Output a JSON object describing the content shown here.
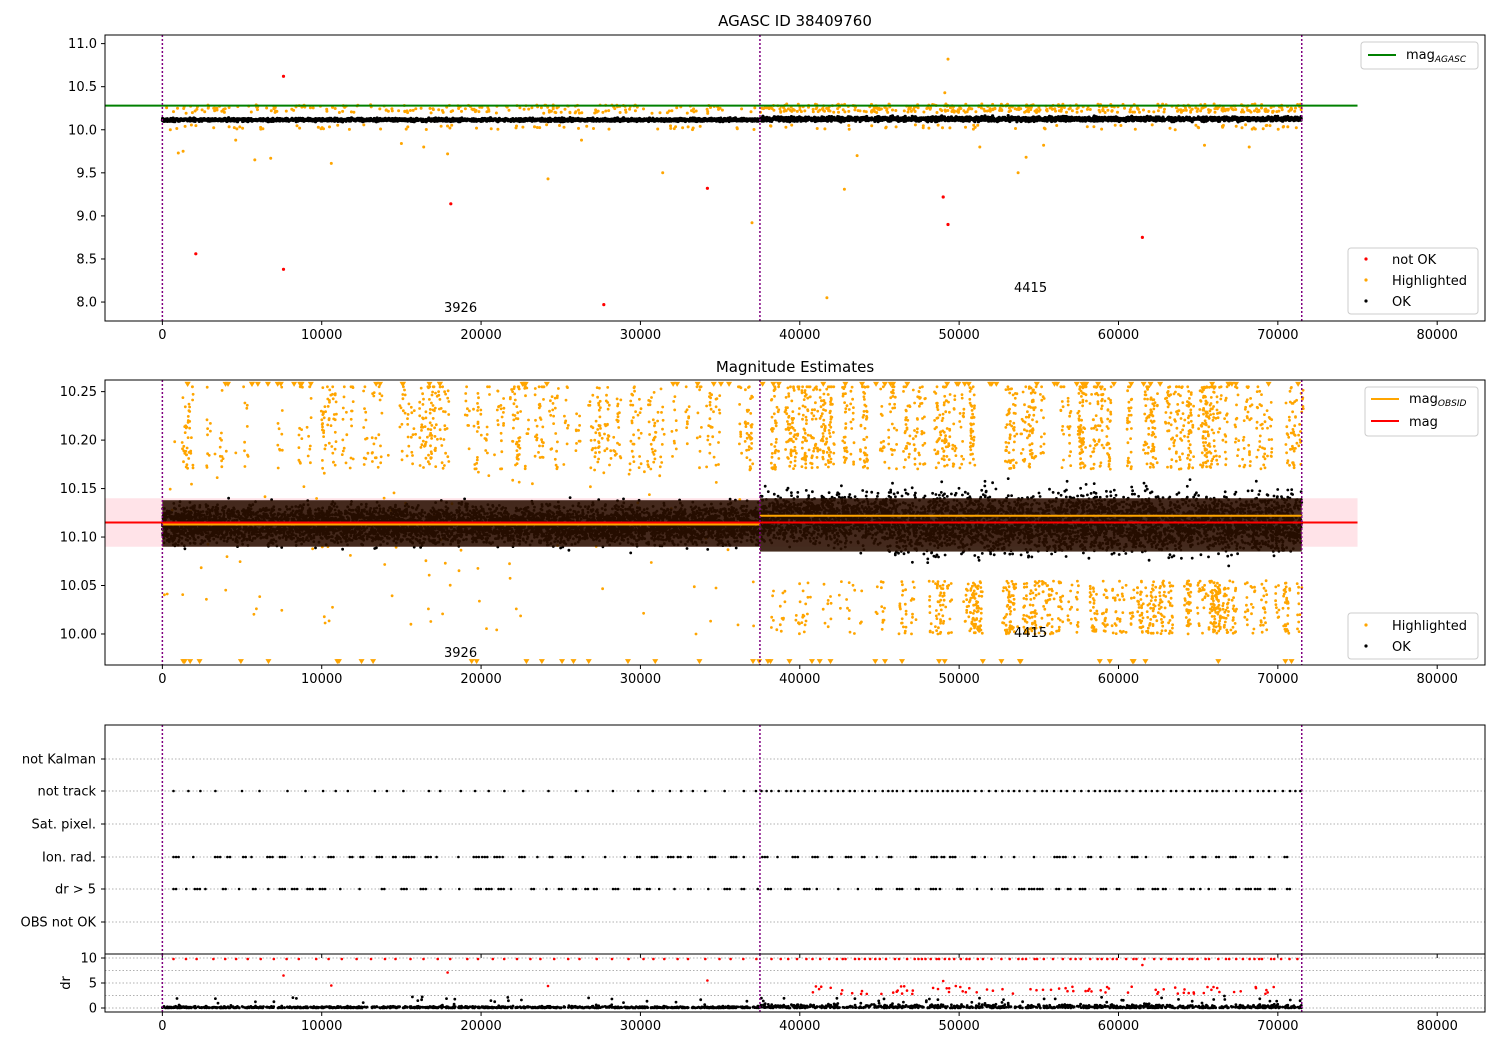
{
  "colors": {
    "ok": "#000000",
    "highlighted": "#ffa500",
    "not_ok": "#ff0000",
    "mag_agasc": "#008000",
    "mag_obsid": "#ffa500",
    "mag": "#ff0000",
    "mag_band": "#ffc0cb",
    "obs_band": "#2a0f00",
    "obs_boundary": "#800080"
  },
  "obsids": [
    {
      "label": "3926",
      "start": 0,
      "end": 37500
    },
    {
      "label": "4415",
      "start": 37500,
      "end": 71500
    }
  ],
  "chart_data": [
    {
      "type": "scatter",
      "title": "AGASC ID 38409760",
      "xlim": [
        -3600,
        83000
      ],
      "ylim": [
        7.78,
        11.1
      ],
      "xticks": [
        "0",
        "10000",
        "20000",
        "30000",
        "40000",
        "50000",
        "60000",
        "70000",
        "80000"
      ],
      "yticks": [
        "8.0",
        "8.5",
        "9.0",
        "9.5",
        "10.0",
        "10.5",
        "11.0"
      ],
      "legend_lines": [
        {
          "label": "mag",
          "subscript": "AGASC"
        }
      ],
      "legend_points": [
        "not OK",
        "Highlighted",
        "OK"
      ],
      "legend_lines_position": "top-right",
      "legend_points_position": "bottom-right",
      "reference_lines": [
        {
          "name": "mag_AGASC",
          "y": 10.28,
          "x": [
            -3600,
            75000
          ]
        }
      ],
      "series": [
        {
          "name": "OK",
          "x_range": [
            0,
            71500
          ],
          "y_band": {
            "3926": [
              10.07,
              10.17
            ],
            "4415": [
              10.05,
              10.2
            ]
          }
        },
        {
          "name": "Highlighted",
          "points": [
            [
              1000,
              9.73
            ],
            [
              1300,
              9.75
            ],
            [
              4600,
              9.88
            ],
            [
              5800,
              9.65
            ],
            [
              6800,
              9.67
            ],
            [
              10600,
              9.61
            ],
            [
              15000,
              9.84
            ],
            [
              16400,
              9.8
            ],
            [
              17900,
              9.72
            ],
            [
              24200,
              9.43
            ],
            [
              26300,
              9.88
            ],
            [
              31400,
              9.5
            ],
            [
              37000,
              8.92
            ],
            [
              41700,
              8.05
            ],
            [
              42800,
              9.31
            ],
            [
              43600,
              9.7
            ],
            [
              49300,
              10.82
            ],
            [
              49100,
              10.43
            ],
            [
              51300,
              9.8
            ],
            [
              55300,
              9.82
            ],
            [
              53700,
              9.5
            ],
            [
              54200,
              9.68
            ],
            [
              65400,
              9.82
            ],
            [
              68200,
              9.8
            ]
          ]
        },
        {
          "name": "not OK",
          "points": [
            [
              2100,
              8.56
            ],
            [
              7600,
              10.62
            ],
            [
              7600,
              8.38
            ],
            [
              18100,
              9.14
            ],
            [
              27700,
              7.97
            ],
            [
              34200,
              9.32
            ],
            [
              49000,
              9.22
            ],
            [
              49300,
              8.9
            ],
            [
              61500,
              8.75
            ]
          ]
        }
      ],
      "annotations": [
        {
          "text": "3926",
          "x": 18700,
          "y": 7.9
        },
        {
          "text": "4415",
          "x": 54500,
          "y": 8.13
        }
      ]
    },
    {
      "type": "scatter",
      "title": "Magnitude Estimates",
      "xlim": [
        -3600,
        83000
      ],
      "ylim": [
        9.968,
        10.262
      ],
      "xticks": [
        "0",
        "10000",
        "20000",
        "30000",
        "40000",
        "50000",
        "60000",
        "70000",
        "80000"
      ],
      "yticks": [
        "10.00",
        "10.05",
        "10.10",
        "10.15",
        "10.20",
        "10.25"
      ],
      "legend_lines": [
        {
          "label": "mag",
          "subscript": "OBSID"
        },
        {
          "label": "mag",
          "subscript": ""
        }
      ],
      "legend_points": [
        "Highlighted",
        "OK"
      ],
      "legend_lines_position": "top-right",
      "legend_points_position": "bottom-right",
      "reference_lines": [
        {
          "name": "mag_OBSID",
          "obsid": "3926",
          "y": 10.113,
          "x": [
            0,
            37500
          ]
        },
        {
          "name": "mag_OBSID",
          "obsid": "4415",
          "y": 10.122,
          "x": [
            37500,
            71500
          ]
        },
        {
          "name": "mag",
          "y": 10.115,
          "x": [
            -3600,
            75000
          ]
        }
      ],
      "mag_band": {
        "y": [
          10.09,
          10.14
        ],
        "x": [
          -3600,
          75000
        ]
      },
      "obs_bands": [
        {
          "obsid": "3926",
          "y": [
            10.09,
            10.138
          ],
          "x": [
            0,
            37500
          ]
        },
        {
          "obsid": "4415",
          "y": [
            10.085,
            10.14
          ],
          "x": [
            37500,
            71500
          ]
        }
      ],
      "series": [
        {
          "name": "OK",
          "per_obsid": {
            "3926": {
              "core": [
                10.08,
                10.15
              ],
              "tail": [
                10.045,
                10.175
              ]
            },
            "4415": {
              "core": [
                10.07,
                10.17
              ],
              "tail": [
                10.035,
                10.205
              ]
            }
          }
        },
        {
          "name": "Highlighted",
          "note": "above 10.17 and below 10.05, clipped at axis limits"
        }
      ],
      "annotations": [
        {
          "text": "3926",
          "x": 18700,
          "y": 9.978
        },
        {
          "text": "4415",
          "x": 54500,
          "y": 10.001
        }
      ]
    },
    {
      "type": "scatter",
      "title": "",
      "xlim": [
        -3600,
        83000
      ],
      "categories": [
        "not Kalman",
        "not track",
        "Sat. pixel.",
        "Ion. rad.",
        "dr > 5",
        "OBS not OK"
      ],
      "flagged": {
        "not Kalman": false,
        "not track": true,
        "Sat. pixel.": false,
        "Ion. rad.": true,
        "dr > 5": true,
        "OBS not OK": false
      }
    },
    {
      "type": "scatter",
      "title": "",
      "xlim": [
        -3600,
        83000
      ],
      "xticks": [
        "0",
        "10000",
        "20000",
        "30000",
        "40000",
        "50000",
        "60000",
        "70000",
        "80000"
      ],
      "ylim": [
        -0.8,
        10.8
      ],
      "yticks": [
        "0",
        "5",
        "10"
      ],
      "ylabel": "dr",
      "series": [
        {
          "name": "OK",
          "y_range": [
            0,
            2.5
          ]
        },
        {
          "name": "not OK",
          "y_value": 9.8,
          "note": "clipped at 10"
        }
      ]
    }
  ],
  "legend_text": {
    "mag_agasc": "mag",
    "mag_agasc_sub": "AGASC",
    "mag_obsid": "mag",
    "mag_obsid_sub": "OBSID",
    "mag": "mag",
    "not_ok": "not OK",
    "highlighted": "Highlighted",
    "ok": "OK"
  }
}
